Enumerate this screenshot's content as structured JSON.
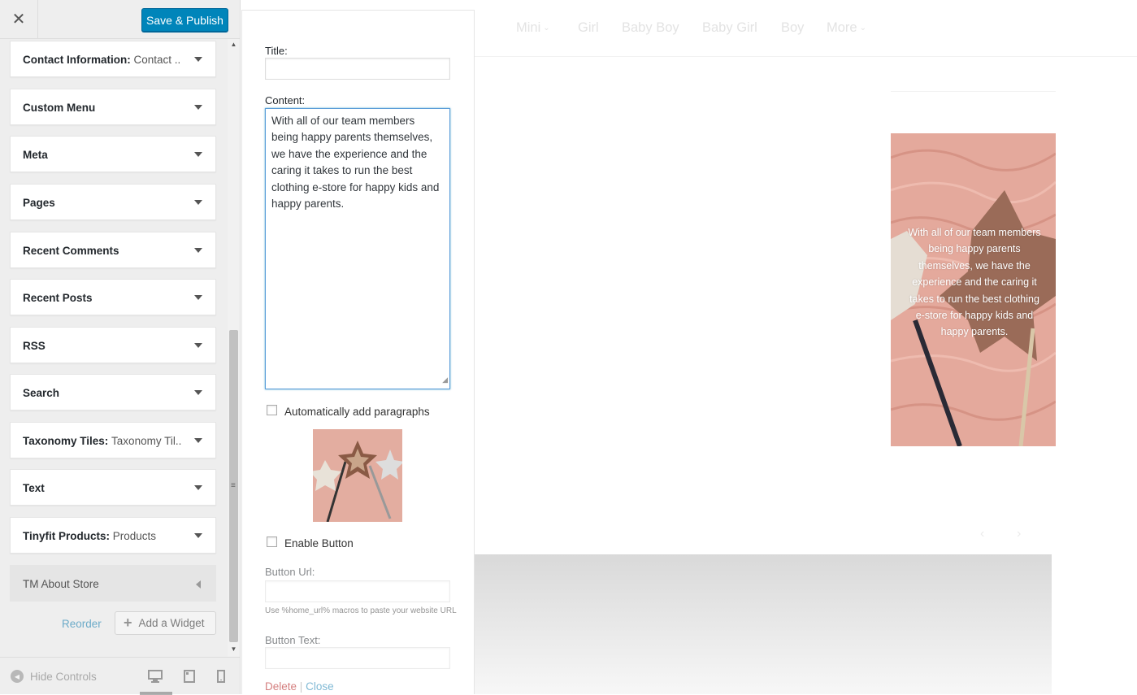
{
  "toolbar": {
    "close_glyph": "✕",
    "publish_label": "Save & Publish"
  },
  "widgets": [
    {
      "title": "Contact Information:",
      "subtitle": "Contact ..."
    },
    {
      "title": "Custom Menu",
      "subtitle": ""
    },
    {
      "title": "Meta",
      "subtitle": ""
    },
    {
      "title": "Pages",
      "subtitle": ""
    },
    {
      "title": "Recent Comments",
      "subtitle": ""
    },
    {
      "title": "Recent Posts",
      "subtitle": ""
    },
    {
      "title": "RSS",
      "subtitle": ""
    },
    {
      "title": "Search",
      "subtitle": ""
    },
    {
      "title": "Taxonomy Tiles:",
      "subtitle": "Taxonomy Til..."
    },
    {
      "title": "Text",
      "subtitle": ""
    },
    {
      "title": "Tinyfit Products:",
      "subtitle": "Products"
    },
    {
      "title": "TM About Store",
      "subtitle": ""
    }
  ],
  "sidebar_actions": {
    "reorder": "Reorder",
    "add_widget": "Add a Widget",
    "add_icon": "plus-icon"
  },
  "footer": {
    "hide_controls": "Hide Controls"
  },
  "form": {
    "title_label": "Title:",
    "title_value": "",
    "content_label": "Content:",
    "content_value": "With all of our team members being happy parents themselves, we have the experience and the caring it takes to run the best clothing e-store for happy kids and happy parents.",
    "auto_paragraphs_label": "Automatically add paragraphs",
    "auto_paragraphs_checked": false,
    "enable_button_label": "Enable Button",
    "enable_button_checked": false,
    "button_url_label": "Button Url:",
    "button_url_value": "",
    "button_url_help": "Use %home_url% macros to paste your website URL",
    "button_text_label": "Button Text:",
    "button_text_value": "",
    "delete_label": "Delete",
    "separator": "|",
    "close_label": "Close"
  },
  "preview": {
    "nav_items": [
      "Mini",
      "Girl",
      "Baby Boy",
      "Baby Girl",
      "Boy",
      "More"
    ],
    "about_text": "With all of our team members being happy parents themselves, we have the experience and the caring it takes to run the best clothing e-store for happy kids and happy parents.",
    "prev_glyph": "‹",
    "next_glyph": "›"
  },
  "colors": {
    "accent": "#0085ba",
    "focus": "#5b9dd9",
    "panel_bg": "#eeeeee",
    "image_pink": "#e8b3a6"
  }
}
